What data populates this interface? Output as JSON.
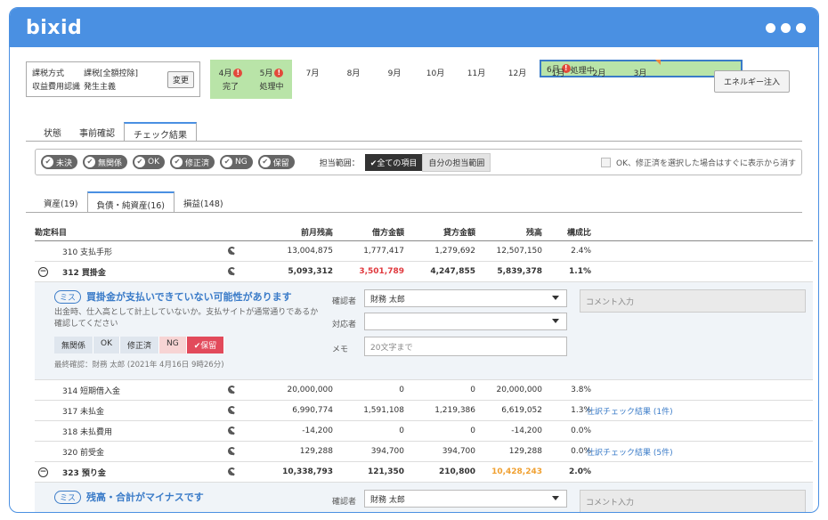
{
  "app": {
    "logo": "bixid"
  },
  "tax": {
    "rows": [
      {
        "key": "課税方式",
        "value": "課税[全額控除]"
      },
      {
        "key": "収益費用認識",
        "value": "発生主義"
      }
    ],
    "change_label": "変更"
  },
  "months": [
    {
      "label": "4月",
      "status": "完了",
      "warn": true,
      "state": "done"
    },
    {
      "label": "5月",
      "status": "処理中",
      "warn": true,
      "state": "done"
    },
    {
      "label": "6月",
      "status": "処理中",
      "warn": true,
      "state": "selected"
    },
    {
      "label": "7月",
      "status": "",
      "warn": false,
      "state": "none"
    },
    {
      "label": "8月",
      "status": "",
      "warn": false,
      "state": "none"
    },
    {
      "label": "9月",
      "status": "",
      "warn": false,
      "state": "none"
    },
    {
      "label": "10月",
      "status": "",
      "warn": false,
      "state": "none"
    },
    {
      "label": "11月",
      "status": "",
      "warn": false,
      "state": "none"
    },
    {
      "label": "12月",
      "status": "",
      "warn": false,
      "state": "none"
    },
    {
      "label": "1月",
      "status": "",
      "warn": false,
      "state": "none"
    },
    {
      "label": "2月",
      "status": "",
      "warn": false,
      "state": "none"
    },
    {
      "label": "3月",
      "status": "",
      "warn": false,
      "state": "none"
    }
  ],
  "warn_glyph": "!",
  "energy_label": "エネルギー注入",
  "main_tabs": [
    "状態",
    "事前確認",
    "チェック結果"
  ],
  "filters": {
    "chips": [
      "未決",
      "無関係",
      "OK",
      "修正済",
      "NG",
      "保留"
    ],
    "check_glyph": "✔",
    "scope_label": "担当範囲：",
    "scope_all": "✔全ての項目",
    "scope_mine": "自分の担当範囲",
    "hide_option": "OK、修正済を選択した場合はすぐに表示から消す"
  },
  "sub_tabs": [
    "資産(19)",
    "負債・純資産(16)",
    "損益(148)"
  ],
  "table": {
    "headers": {
      "name": "勘定科目",
      "prev": "前月残高",
      "debit": "借方金額",
      "credit": "貸方金額",
      "balance": "残高",
      "ratio": "構成比"
    },
    "minus_glyph": "−",
    "rows": [
      {
        "name": "310 支払手形",
        "prev": "13,004,875",
        "debit": "1,777,417",
        "credit": "1,279,692",
        "balance": "12,507,150",
        "ratio": "2.4%",
        "link": ""
      },
      {
        "name": "312 買掛金",
        "prev": "5,093,312",
        "debit": "3,501,789",
        "credit": "4,247,855",
        "balance": "5,839,378",
        "ratio": "1.1%",
        "link": ""
      },
      {
        "name": "314 短期借入金",
        "prev": "20,000,000",
        "debit": "0",
        "credit": "0",
        "balance": "20,000,000",
        "ratio": "3.8%",
        "link": ""
      },
      {
        "name": "317 未払金",
        "prev": "6,990,774",
        "debit": "1,591,108",
        "credit": "1,219,386",
        "balance": "6,619,052",
        "ratio": "1.3%",
        "link": "仕訳チェック結果 (1件)"
      },
      {
        "name": "318 未払費用",
        "prev": "-14,200",
        "debit": "0",
        "credit": "0",
        "balance": "-14,200",
        "ratio": "0.0%",
        "link": ""
      },
      {
        "name": "320 前受金",
        "prev": "129,288",
        "debit": "394,700",
        "credit": "394,700",
        "balance": "129,288",
        "ratio": "0.0%",
        "link": "仕訳チェック結果 (5件)"
      },
      {
        "name": "323 預り金",
        "prev": "10,338,793",
        "debit": "121,350",
        "credit": "210,800",
        "balance": "10,428,243",
        "ratio": "2.0%",
        "link": ""
      }
    ]
  },
  "detail1": {
    "badge": "ミス",
    "title": "買掛金が支払いできていない可能性があります",
    "desc": "出金時、仕入高として計上していないか。支払サイトが通常通りであるか確認してください",
    "status_buttons": [
      "無関係",
      "OK",
      "修正済",
      "NG",
      "✔保留"
    ],
    "last_check": "最終確認：財務 太郎 (2021年 4月16日 9時26分)",
    "checker_label": "確認者",
    "checker_value": "財務 太郎",
    "handler_label": "対応者",
    "handler_value": "",
    "memo_label": "メモ",
    "memo_placeholder": "20文字まで",
    "comment_placeholder": "コメント入力"
  },
  "detail2": {
    "badge": "ミス",
    "title": "残高・合計がマイナスです",
    "checker_label": "確認者",
    "checker_value": "財務 太郎",
    "comment_placeholder": "コメント入力"
  },
  "colors": {
    "brand": "#4a90e2",
    "done_month": "#b9e4a8",
    "warn": "#e24a3b",
    "negative": "#e0393e",
    "highlight": "#f0a030"
  }
}
